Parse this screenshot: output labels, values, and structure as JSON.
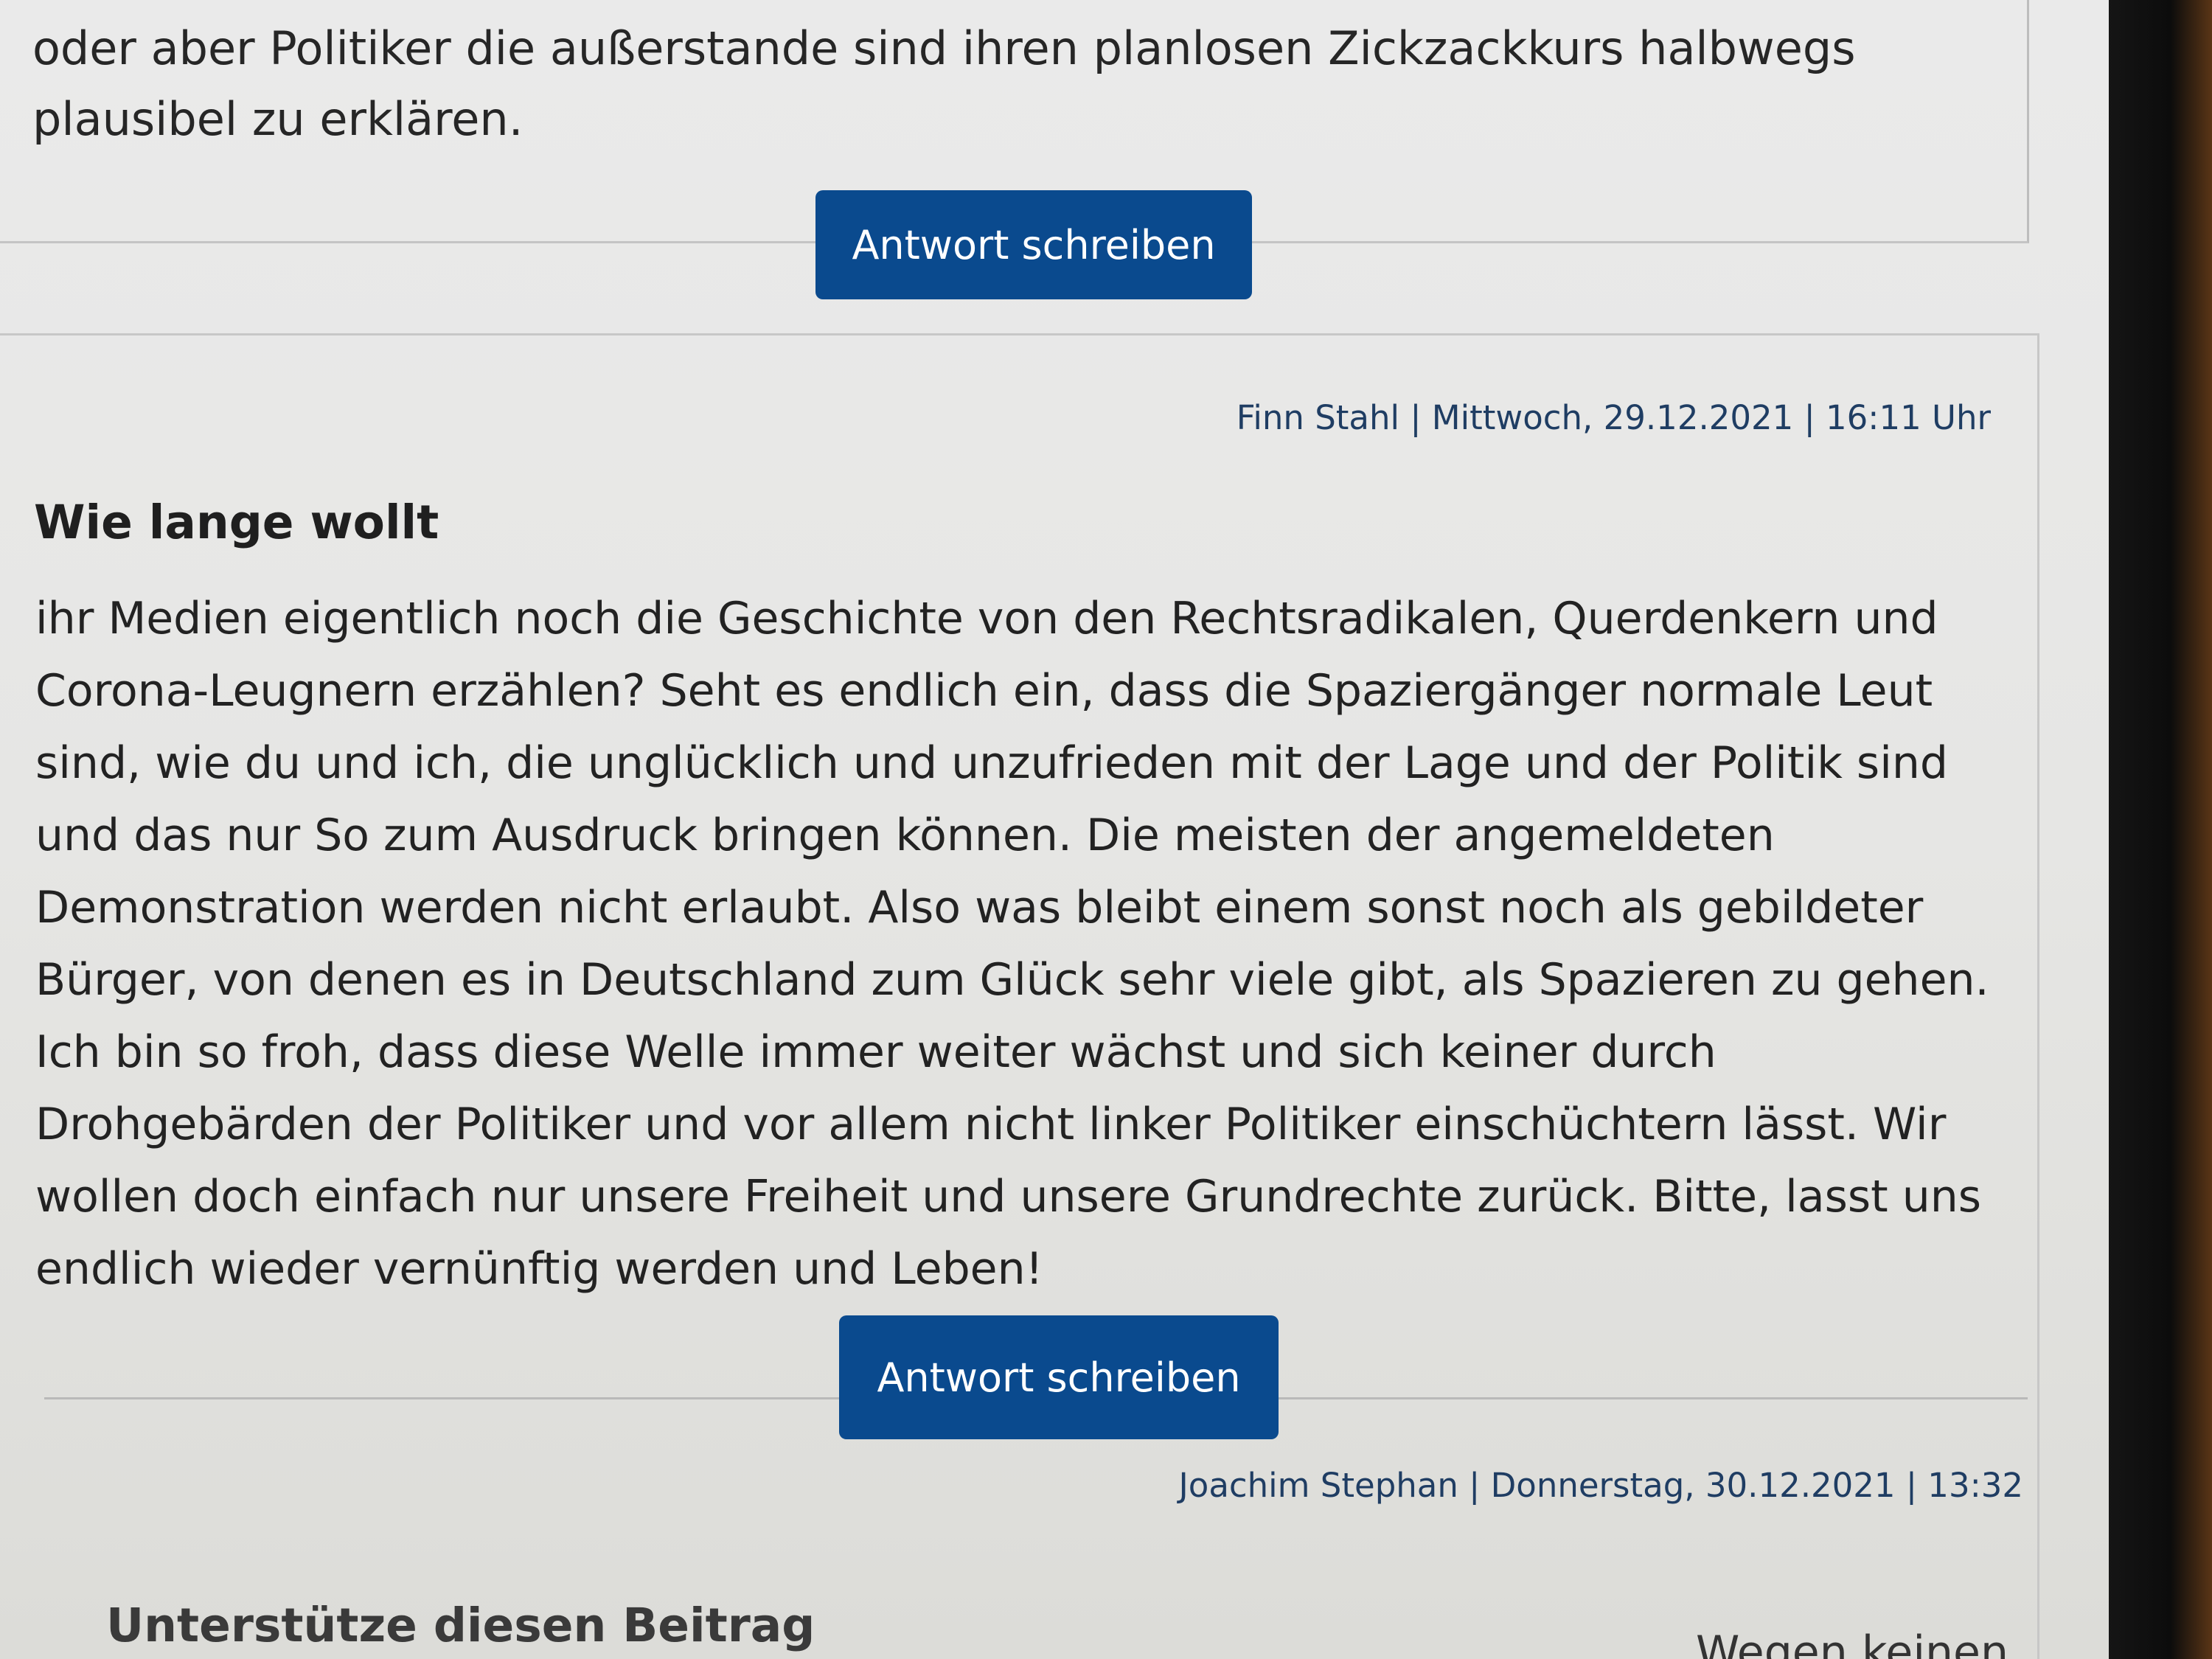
{
  "previous_comment": {
    "body": "oder aber Politiker die außerstande sind ihren planlosen Zickzackkurs halbwegs plausibel zu erklären.",
    "reply_button": "Antwort schreiben"
  },
  "comment": {
    "meta": "Finn Stahl | Mittwoch, 29.12.2021 | 16:11 Uhr",
    "title": "Wie lange wollt",
    "body": "ihr Medien eigentlich noch die Geschichte von den Rechtsradikalen, Querdenkern und Corona-Leugnern erzählen? Seht es endlich ein, dass die Spaziergänger normale Leut sind, wie du und ich, die unglücklich und unzufrieden mit der Lage und der Politik sind und das nur So zum Ausdruck bringen können. Die meisten der angemeldeten Demonstration werden nicht erlaubt. Also was bleibt einem sonst noch als gebildeter Bürger, von denen es in Deutschland zum Glück sehr viele gibt, als Spazieren zu gehen. Ich bin so froh, dass diese Welle immer weiter wächst und sich keiner durch Drohgebärden der Politiker und vor allem nicht linker Politiker einschüchtern lässt. Wir wollen doch einfach nur unsere Freiheit und unsere Grundrechte zurück. Bitte, lasst uns endlich wieder vernünftig werden und Leben!",
    "reply_button": "Antwort schreiben"
  },
  "next_comment": {
    "meta": "Joachim Stephan | Donnerstag, 30.12.2021 | 13:32",
    "support_heading": "Unterstütze diesen Beitrag",
    "fragment_right": "Wegen keinen"
  }
}
